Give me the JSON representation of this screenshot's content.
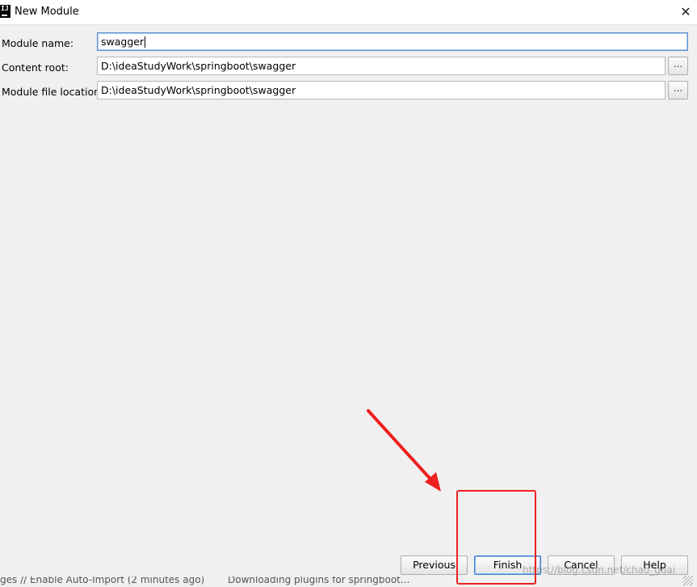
{
  "window": {
    "title": "New Module",
    "icon": "intellij-app-icon",
    "icon_text": "IJ",
    "close_glyph": "✕"
  },
  "form": {
    "module_name_label": "Module name:",
    "module_name_value": "swagger",
    "content_root_label": "Content root:",
    "content_root_value": "D:\\ideaStudyWork\\springboot\\swagger",
    "module_file_location_label": "Module file location:",
    "module_file_location_value": "D:\\ideaStudyWork\\springboot\\swagger",
    "browse_label": "..."
  },
  "buttons": {
    "previous": "Previous",
    "finish": "Finish",
    "cancel": "Cancel",
    "help": "Help"
  },
  "status": {
    "left": "ges // Enable Auto-Import (2 minutes ago)",
    "right": "Downloading plugins for springboot..."
  },
  "watermark": "https://blog.csdn.net/chao_guai",
  "colors": {
    "accent": "#3c7fd1",
    "annotation": "#ee1f1f",
    "background": "#f0f0f0"
  }
}
